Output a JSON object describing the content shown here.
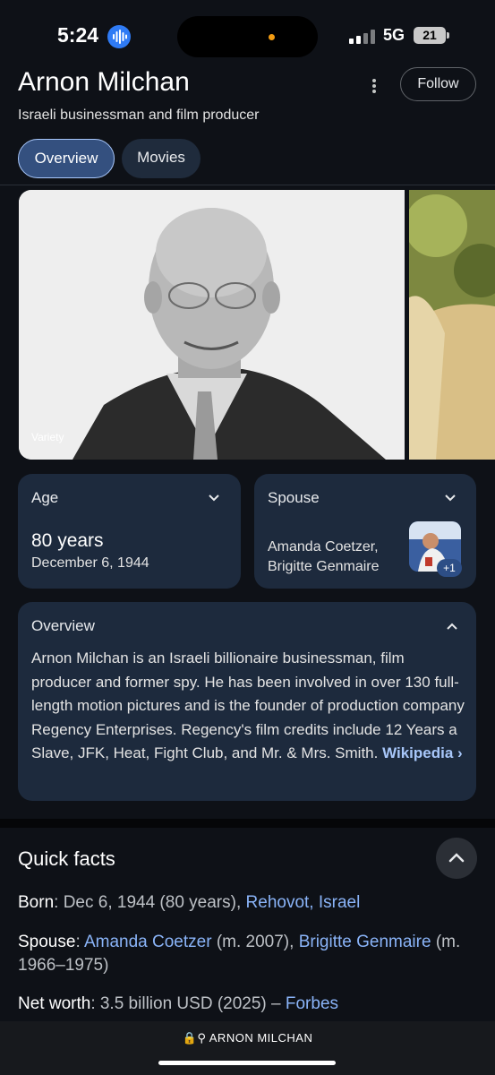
{
  "status": {
    "time": "5:24",
    "network": "5G",
    "battery": "21"
  },
  "header": {
    "title": "Arnon Milchan",
    "subtitle": "Israeli businessman and film producer",
    "follow_label": "Follow"
  },
  "tabs": [
    {
      "label": "Overview"
    },
    {
      "label": "Movies"
    }
  ],
  "images": {
    "source": "Variety"
  },
  "age": {
    "label": "Age",
    "value": "80 years",
    "date": "December 6, 1944"
  },
  "spouse": {
    "label": "Spouse",
    "names": "Amanda Coetzer, Brigitte Genmaire",
    "more": "+1"
  },
  "overview": {
    "label": "Overview",
    "text": "Arnon Milchan is an Israeli billionaire businessman, film producer and former spy. He has been involved in over 130 full-length motion pictures and is the founder of production company Regency Enterprises. Regency's film credits include 12 Years a Slave, JFK, Heat, Fight Club, and Mr. & Mrs. Smith.",
    "link": "Wikipedia"
  },
  "quick_facts": {
    "title": "Quick facts",
    "born": {
      "label": "Born",
      "value": ": Dec 6, 1944 (80 years), ",
      "link": "Rehovot, Israel"
    },
    "spouse": {
      "label": "Spouse",
      "sep1": ": ",
      "link1": "Amanda Coetzer",
      "mid": " (m. 2007), ",
      "link2": "Brigitte Genmaire",
      "tail": " (m. 1966–1975)"
    },
    "net_worth": {
      "label": "Net worth",
      "value": ": 3.5 billion USD (2025) – ",
      "link": "Forbes"
    }
  },
  "browser": {
    "url": "ARNON MILCHAN"
  },
  "colors": {
    "background": "#0e1117",
    "card": "#1d2a3d",
    "accent": "#a8c7fa",
    "link": "#8ab4f8"
  }
}
